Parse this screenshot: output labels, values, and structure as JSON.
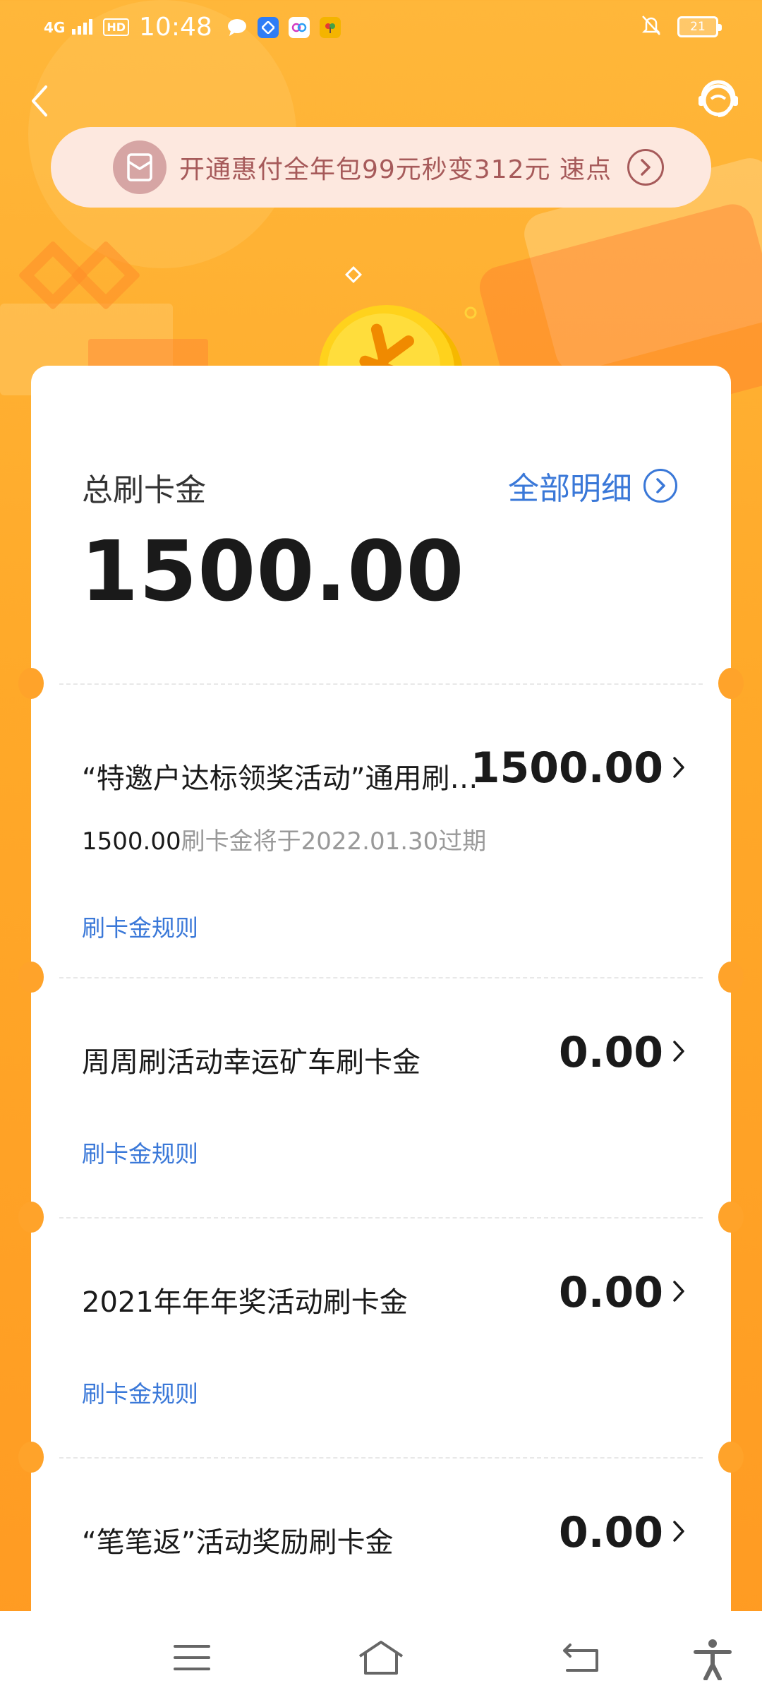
{
  "status_bar": {
    "network": "4G",
    "hd": "HD",
    "time": "10:48",
    "battery": "21"
  },
  "promo": {
    "text": "开通惠付全年包99元秒变312元  速点"
  },
  "summary": {
    "label": "总刷卡金",
    "detail_link": "全部明细",
    "total": "1500.00"
  },
  "items": [
    {
      "title": "“特邀户达标领奖活动”通用刷…",
      "amount": "1500.00",
      "note_amount": "1500.00",
      "note_text": "刷卡金将于2022.01.30过期",
      "rule": "刷卡金规则"
    },
    {
      "title": "周周刷活动幸运矿车刷卡金",
      "amount": "0.00",
      "rule": "刷卡金规则"
    },
    {
      "title": "2021年年年奖活动刷卡金",
      "amount": "0.00",
      "rule": "刷卡金规则"
    },
    {
      "title": "“笔笔返”活动奖励刷卡金",
      "amount": "0.00"
    }
  ],
  "icons": {
    "back": "chevron-left-icon",
    "service": "customer-service-icon",
    "menu": "menu-icon",
    "home": "home-icon",
    "return": "return-icon",
    "accessibility": "accessibility-icon"
  },
  "colors": {
    "background": "#ffa929",
    "link": "#3a78d8",
    "promo_bg": "#fde8df",
    "promo_text": "#a65a5a"
  }
}
